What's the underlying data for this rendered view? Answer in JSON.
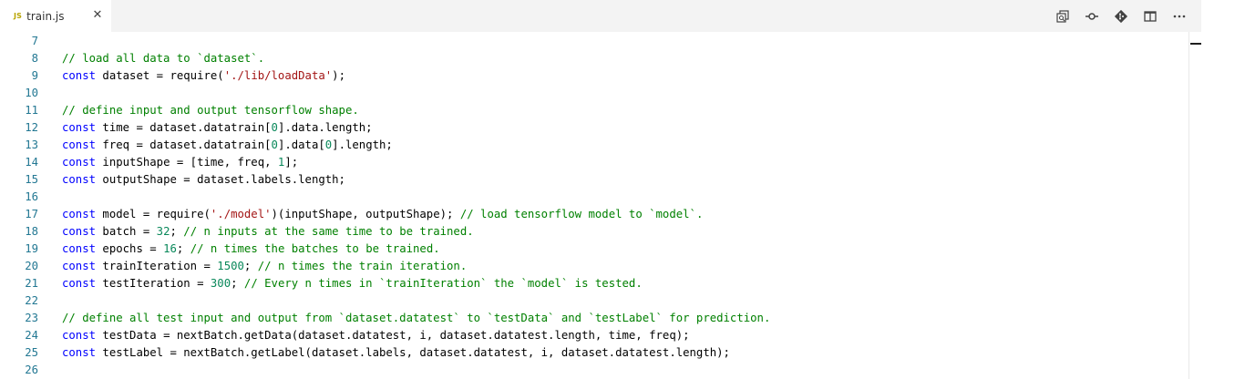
{
  "tab": {
    "badge": "JS",
    "filename": "train.js",
    "close_glyph": "✕"
  },
  "toolbar": {
    "icons": [
      "open-changes-icon",
      "toggle-inline-diff-icon",
      "git-compare-icon",
      "split-editor-icon",
      "more-actions-icon"
    ],
    "more_glyph": "···"
  },
  "colors": {
    "keyword": "#0000ff",
    "comment": "#008000",
    "string": "#a31515",
    "number": "#09885a",
    "line_number": "#237893"
  },
  "lines": [
    {
      "n": "7",
      "tokens": []
    },
    {
      "n": "8",
      "tokens": [
        {
          "t": "cm",
          "v": "// load all data to `dataset`."
        }
      ]
    },
    {
      "n": "9",
      "tokens": [
        {
          "t": "kw",
          "v": "const"
        },
        {
          "t": "tx",
          "v": " dataset = require("
        },
        {
          "t": "st",
          "v": "'./lib/loadData'"
        },
        {
          "t": "tx",
          "v": ");"
        }
      ]
    },
    {
      "n": "10",
      "tokens": []
    },
    {
      "n": "11",
      "tokens": [
        {
          "t": "cm",
          "v": "// define input and output tensorflow shape."
        }
      ]
    },
    {
      "n": "12",
      "tokens": [
        {
          "t": "kw",
          "v": "const"
        },
        {
          "t": "tx",
          "v": " time = dataset.datatrain["
        },
        {
          "t": "nm",
          "v": "0"
        },
        {
          "t": "tx",
          "v": "].data.length;"
        }
      ]
    },
    {
      "n": "13",
      "tokens": [
        {
          "t": "kw",
          "v": "const"
        },
        {
          "t": "tx",
          "v": " freq = dataset.datatrain["
        },
        {
          "t": "nm",
          "v": "0"
        },
        {
          "t": "tx",
          "v": "].data["
        },
        {
          "t": "nm",
          "v": "0"
        },
        {
          "t": "tx",
          "v": "].length;"
        }
      ]
    },
    {
      "n": "14",
      "tokens": [
        {
          "t": "kw",
          "v": "const"
        },
        {
          "t": "tx",
          "v": " inputShape = [time, freq, "
        },
        {
          "t": "nm",
          "v": "1"
        },
        {
          "t": "tx",
          "v": "];"
        }
      ]
    },
    {
      "n": "15",
      "tokens": [
        {
          "t": "kw",
          "v": "const"
        },
        {
          "t": "tx",
          "v": " outputShape = dataset.labels.length;"
        }
      ]
    },
    {
      "n": "16",
      "tokens": []
    },
    {
      "n": "17",
      "tokens": [
        {
          "t": "kw",
          "v": "const"
        },
        {
          "t": "tx",
          "v": " model = require("
        },
        {
          "t": "st",
          "v": "'./model'"
        },
        {
          "t": "tx",
          "v": ")(inputShape, outputShape); "
        },
        {
          "t": "cm",
          "v": "// load tensorflow model to `model`."
        }
      ]
    },
    {
      "n": "18",
      "tokens": [
        {
          "t": "kw",
          "v": "const"
        },
        {
          "t": "tx",
          "v": " batch = "
        },
        {
          "t": "nm",
          "v": "32"
        },
        {
          "t": "tx",
          "v": "; "
        },
        {
          "t": "cm",
          "v": "// n inputs at the same time to be trained."
        }
      ]
    },
    {
      "n": "19",
      "tokens": [
        {
          "t": "kw",
          "v": "const"
        },
        {
          "t": "tx",
          "v": " epochs = "
        },
        {
          "t": "nm",
          "v": "16"
        },
        {
          "t": "tx",
          "v": "; "
        },
        {
          "t": "cm",
          "v": "// n times the batches to be trained."
        }
      ]
    },
    {
      "n": "20",
      "tokens": [
        {
          "t": "kw",
          "v": "const"
        },
        {
          "t": "tx",
          "v": " trainIteration = "
        },
        {
          "t": "nm",
          "v": "1500"
        },
        {
          "t": "tx",
          "v": "; "
        },
        {
          "t": "cm",
          "v": "// n times the train iteration."
        }
      ]
    },
    {
      "n": "21",
      "tokens": [
        {
          "t": "kw",
          "v": "const"
        },
        {
          "t": "tx",
          "v": " testIteration = "
        },
        {
          "t": "nm",
          "v": "300"
        },
        {
          "t": "tx",
          "v": "; "
        },
        {
          "t": "cm",
          "v": "// Every n times in `trainIteration` the `model` is tested."
        }
      ]
    },
    {
      "n": "22",
      "tokens": []
    },
    {
      "n": "23",
      "tokens": [
        {
          "t": "cm",
          "v": "// define all test input and output from `dataset.datatest` to `testData` and `testLabel` for prediction."
        }
      ]
    },
    {
      "n": "24",
      "tokens": [
        {
          "t": "kw",
          "v": "const"
        },
        {
          "t": "tx",
          "v": " testData = nextBatch.getData(dataset.datatest, i, dataset.datatest.length, time, freq);"
        }
      ]
    },
    {
      "n": "25",
      "tokens": [
        {
          "t": "kw",
          "v": "const"
        },
        {
          "t": "tx",
          "v": " testLabel = nextBatch.getLabel(dataset.labels, dataset.datatest, i, dataset.datatest.length);"
        }
      ]
    },
    {
      "n": "26",
      "tokens": []
    }
  ]
}
